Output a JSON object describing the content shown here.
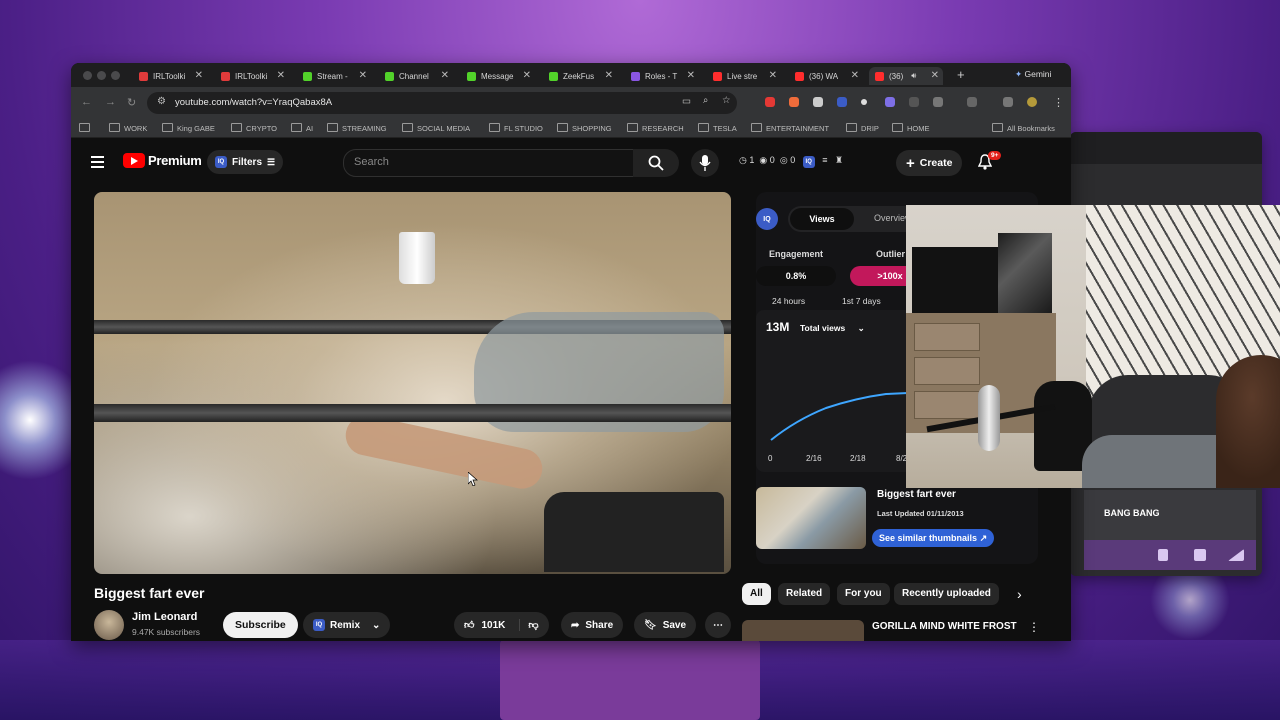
{
  "browser": {
    "tabs": [
      {
        "label": "IRLToolki",
        "color": "#e03b3b"
      },
      {
        "label": "IRLToolki",
        "color": "#e03b3b"
      },
      {
        "label": "Stream -",
        "color": "#52d22a"
      },
      {
        "label": "Channel",
        "color": "#52d22a"
      },
      {
        "label": "Message",
        "color": "#52d22a"
      },
      {
        "label": "ZeekFus",
        "color": "#52d22a"
      },
      {
        "label": "Roles - T",
        "color": "#8a56e2"
      },
      {
        "label": "Live stre",
        "color": "#ff2d2d"
      },
      {
        "label": "(36) WA",
        "color": "#ff2d2d"
      },
      {
        "label": "(36)",
        "color": "#ff2d2d"
      }
    ],
    "gemini_label": "Gemini",
    "url": "youtube.com/watch?v=YraqQabax8A",
    "bookmarks": [
      "WORK",
      "King GABE",
      "CRYPTO",
      "AI",
      "STREAMING",
      "SOCIAL MEDIA",
      "FL STUDIO",
      "SHOPPING",
      "RESEARCH",
      "TESLA",
      "ENTERTAINMENT",
      "DRIP",
      "HOME"
    ],
    "all_bookmarks": "All Bookmarks"
  },
  "youtube": {
    "logo_text": "Premium",
    "filters_label": "Filters",
    "iq_badge": "IQ",
    "search_placeholder": "Search",
    "counters": {
      "a": "1",
      "b": "0",
      "c": "0"
    },
    "create_label": "Create",
    "notif_badge": "9+",
    "video_title": "Biggest fart ever",
    "channel_name": "Jim Leonard",
    "subscribers": "9.47K subscribers",
    "subscribe_label": "Subscribe",
    "remix_label": "Remix",
    "likes": "101K",
    "share_label": "Share",
    "save_label": "Save"
  },
  "iq_panel": {
    "logo": "IQ",
    "tab_views": "Views",
    "tab_overview": "Overview",
    "engagement_label": "Engagement",
    "engagement_value": "0.8%",
    "outlier_label": "Outlier",
    "outlier_value": ">100x",
    "period_24h": "24 hours",
    "period_7d": "1st 7 days",
    "total_value": "13M",
    "total_label": "Total views",
    "chart_ticks": [
      "0",
      "2/16",
      "2/18",
      "8/2"
    ],
    "thumb_title": "Biggest fart ever",
    "last_updated": "Last Updated 01/11/2013",
    "similar_label": "See similar thumbnails"
  },
  "chips": [
    "All",
    "Related",
    "For you",
    "Recently uploaded"
  ],
  "next_video_title": "GORILLA MIND WHITE FROST",
  "overlay": {
    "bang_label": "BANG BANG"
  },
  "colors": {
    "accent_red": "#ff0000",
    "iq_blue": "#3b5cc6",
    "outlier_pink": "#c2185b",
    "similar_blue": "#2f62d6"
  }
}
